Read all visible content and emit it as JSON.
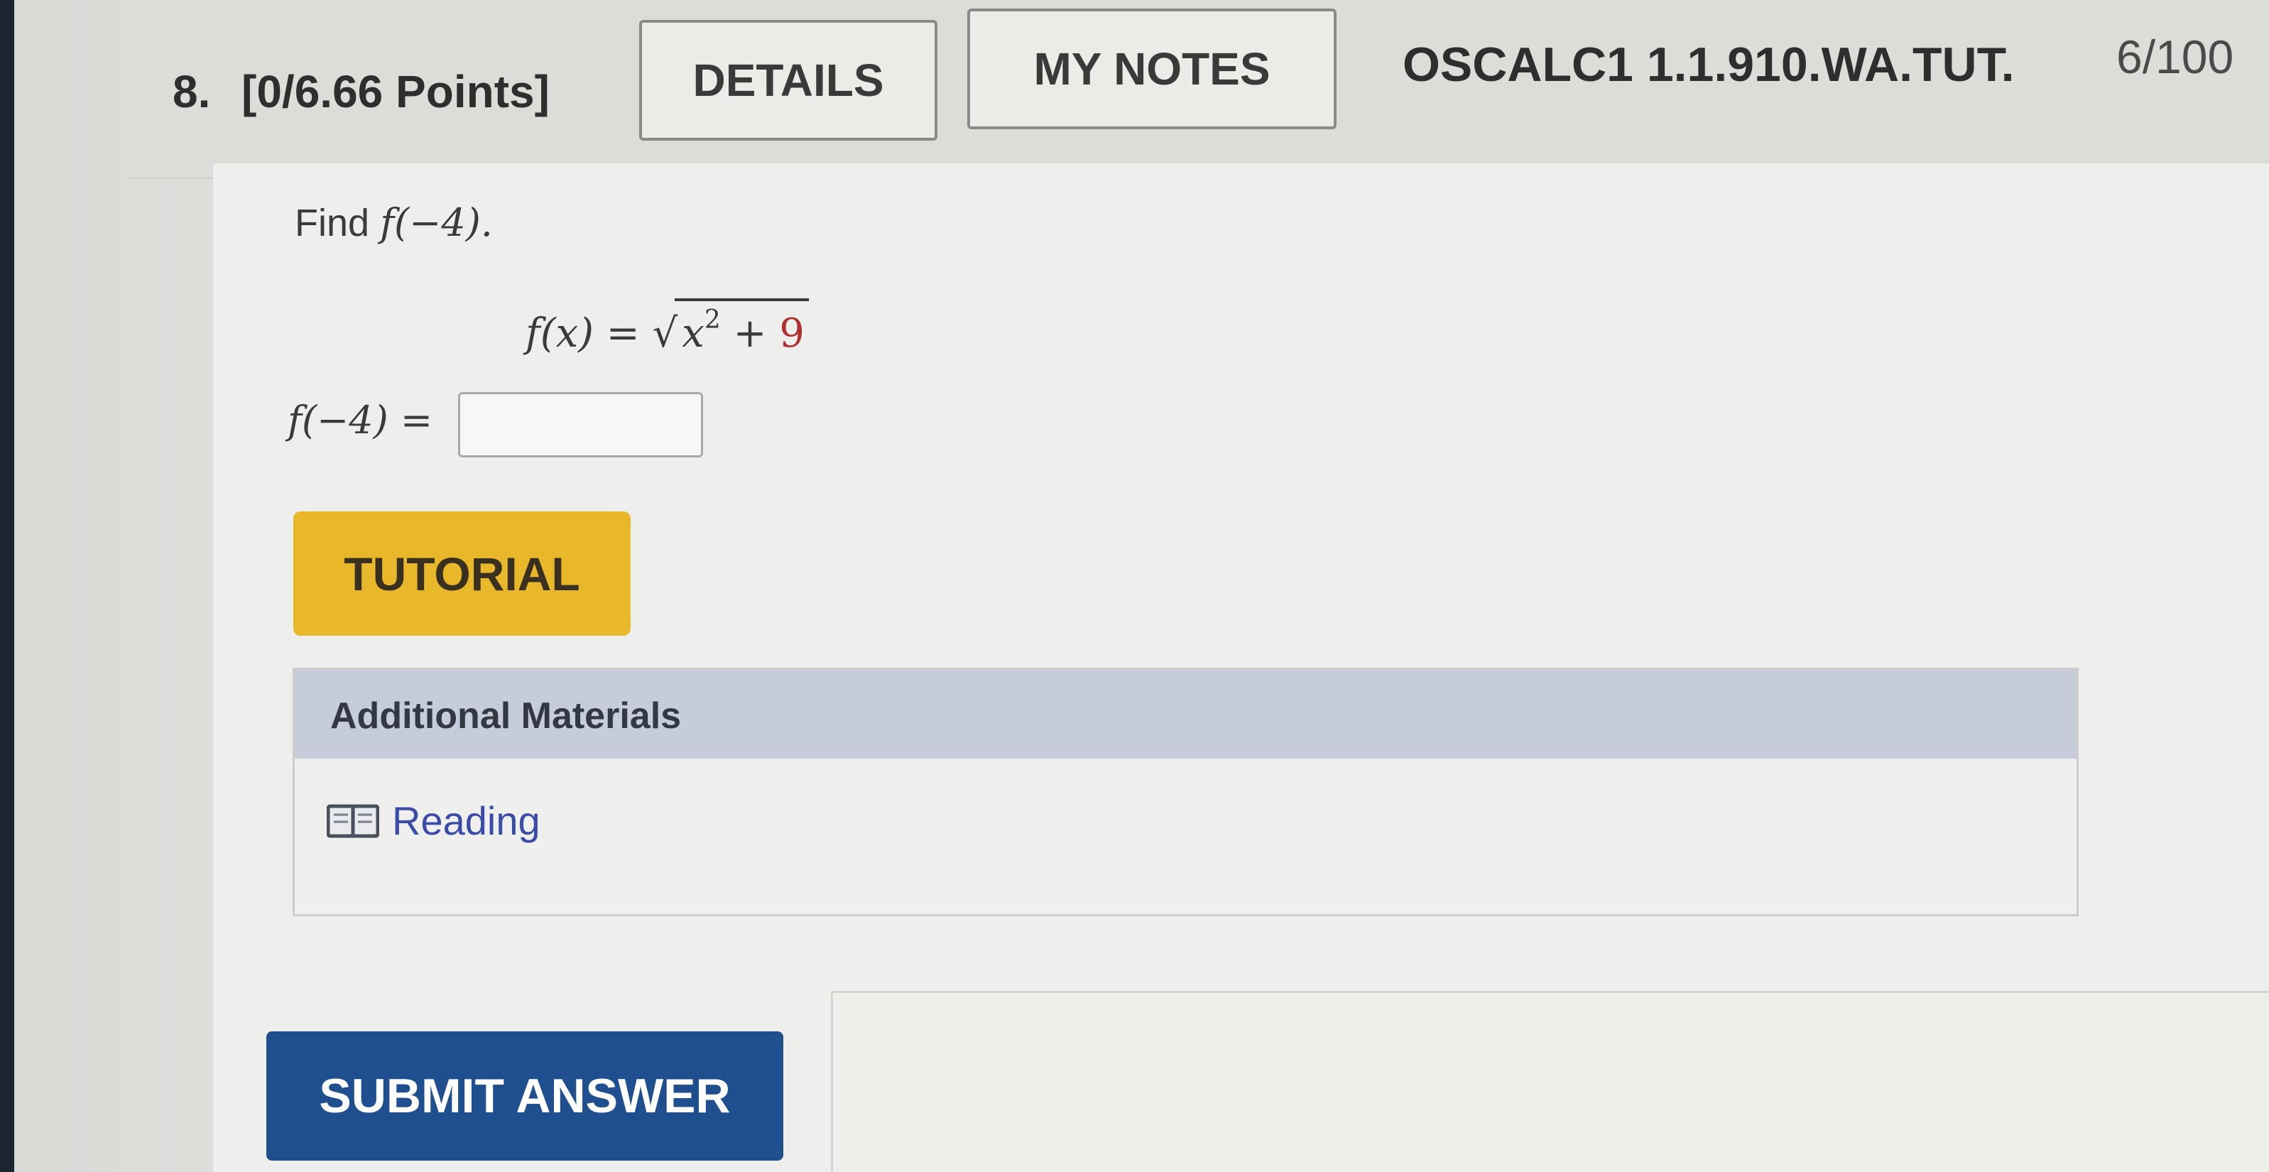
{
  "question": {
    "number": "8.",
    "points": "[0/6.66 Points]",
    "details_label": "DETAILS",
    "my_notes_label": "MY NOTES",
    "assignment_code": "OSCALC1 1.1.910.WA.TUT.",
    "submission_count": "6/100"
  },
  "problem": {
    "find_prefix": "Find ",
    "find_expr": "f(−4).",
    "function_lhs": "f(x) = ",
    "radicand_var": "x",
    "radicand_exp": "2",
    "radicand_rest": " + ",
    "radicand_const": "9",
    "answer_label": "f(−4) = ",
    "answer_value": ""
  },
  "buttons": {
    "tutorial_label": "TUTORIAL",
    "submit_label": "SUBMIT ANSWER"
  },
  "materials": {
    "title": "Additional Materials",
    "reading_label": "Reading",
    "reading_icon": "book-icon"
  },
  "colors": {
    "tutorial_bg": "#e8b82a",
    "submit_bg": "#1f4f8e",
    "materials_header_bg": "#c6ccda",
    "link_color": "#3a4ca8",
    "constant_color": "#b03030"
  }
}
